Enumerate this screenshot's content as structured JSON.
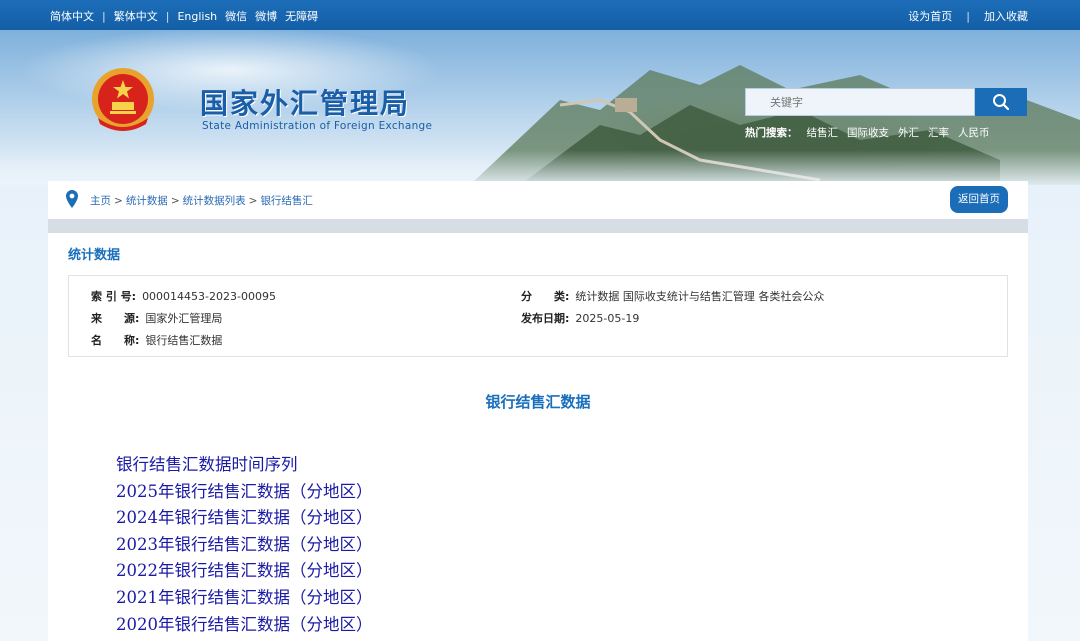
{
  "topbar": {
    "left_links": [
      "简体中文",
      "繁体中文",
      "English",
      "微信",
      "微博",
      "无障碍"
    ],
    "right_links": [
      "设为首页",
      "加入收藏"
    ]
  },
  "header": {
    "title_cn": "国家外汇管理局",
    "title_en": "State Administration of Foreign Exchange",
    "search_placeholder": "关键字",
    "hot_label": "热门搜索：",
    "hot_items": [
      "结售汇",
      "国际收支",
      "外汇",
      "汇率",
      "人民币"
    ]
  },
  "breadcrumb": {
    "items": [
      "主页",
      "统计数据",
      "统计数据列表",
      "银行结售汇"
    ],
    "separator": ">",
    "home_button": "返回首页"
  },
  "main": {
    "section_title": "统计数据",
    "meta": {
      "index_label": "索 引 号:",
      "index_value": "000014453-2023-00095",
      "source_label": "来　　源:",
      "source_value": "国家外汇管理局",
      "name_label": "名　　称:",
      "name_value": "银行结售汇数据",
      "category_label": "分　　类:",
      "category_value": "统计数据  国际收支统计与结售汇管理  各类社会公众",
      "date_label": "发布日期:",
      "date_value": "2025-05-19"
    },
    "doc_title": "银行结售汇数据",
    "links": [
      "银行结售汇数据时间序列",
      "2025年银行结售汇数据（分地区）",
      "2024年银行结售汇数据（分地区）",
      "2023年银行结售汇数据（分地区）",
      "2022年银行结售汇数据（分地区）",
      "2021年银行结售汇数据（分地区）",
      "2020年银行结售汇数据（分地区）"
    ]
  },
  "colors": {
    "brand_blue": "#1c6db8",
    "link_blue": "#1a1aa6",
    "title_blue": "#1a6fbd"
  },
  "icons": [
    "national-emblem-icon",
    "search-icon",
    "location-pin-icon"
  ]
}
